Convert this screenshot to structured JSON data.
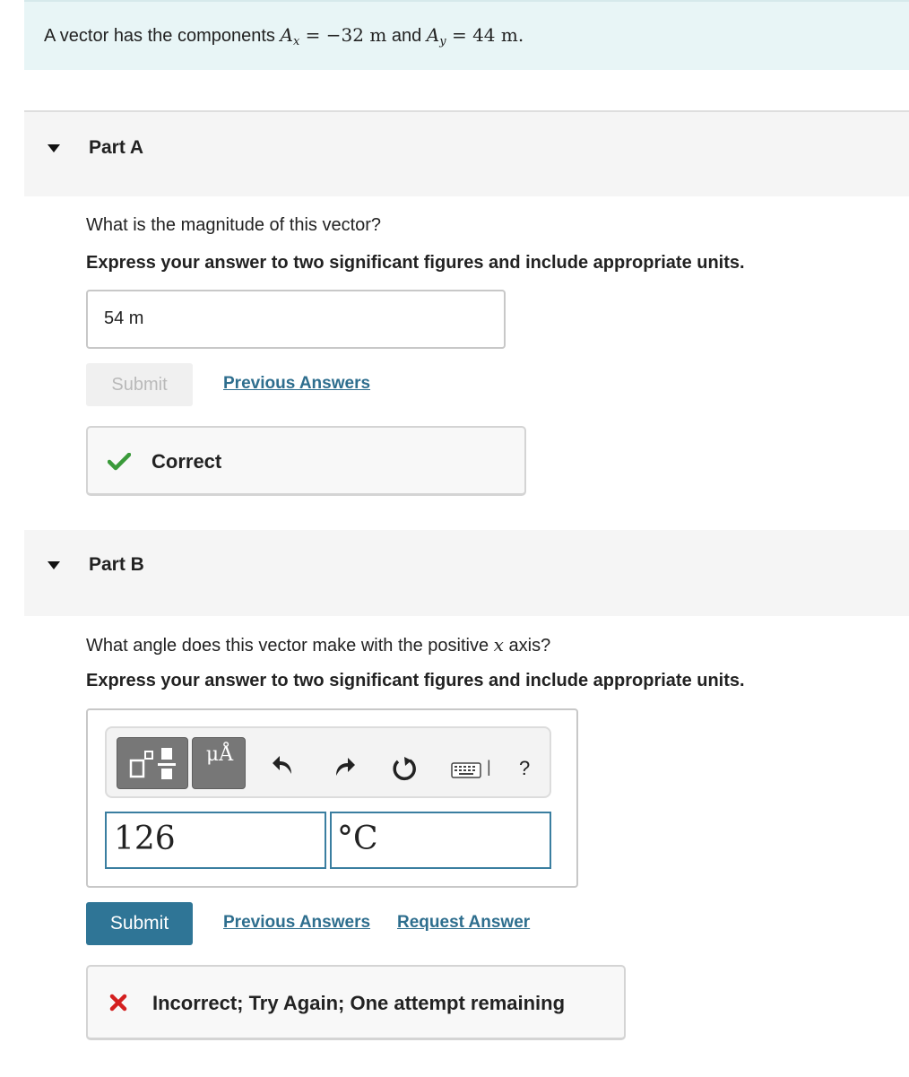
{
  "intro": {
    "lead": "A vector has the components ",
    "ax_symbol": "A",
    "ax_sub": "x",
    "ax_value": " = −32 m",
    "and": " and ",
    "ay_symbol": "A",
    "ay_sub": "y",
    "ay_value": " = 44 m",
    "end": "."
  },
  "part_a": {
    "title": "Part A",
    "question": "What is the magnitude of this vector?",
    "instruction": "Express your answer to two significant figures and include appropriate units.",
    "answer_value": "54 m",
    "submit_label": "Submit",
    "previous_answers_label": "Previous Answers",
    "feedback": "Correct"
  },
  "part_b": {
    "title": "Part B",
    "question_lead": "What angle does this vector make with the positive ",
    "question_var": "x",
    "question_tail": " axis?",
    "instruction": "Express your answer to two significant figures and include appropriate units.",
    "toolbar": {
      "units_label": "μÅ",
      "keyboard_separator": "|",
      "help_label": "?"
    },
    "value_field": "126",
    "units_field": "°C",
    "submit_label": "Submit",
    "previous_answers_label": "Previous Answers",
    "request_answer_label": "Request Answer",
    "feedback": "Incorrect; Try Again; One attempt remaining"
  },
  "colors": {
    "intro_bg": "#e8f5f6",
    "link": "#2e6e8e",
    "submit_bg": "#2f7596",
    "correct_green": "#3a9a3a",
    "incorrect_red": "#d42020",
    "field_border": "#3a7ea0"
  }
}
